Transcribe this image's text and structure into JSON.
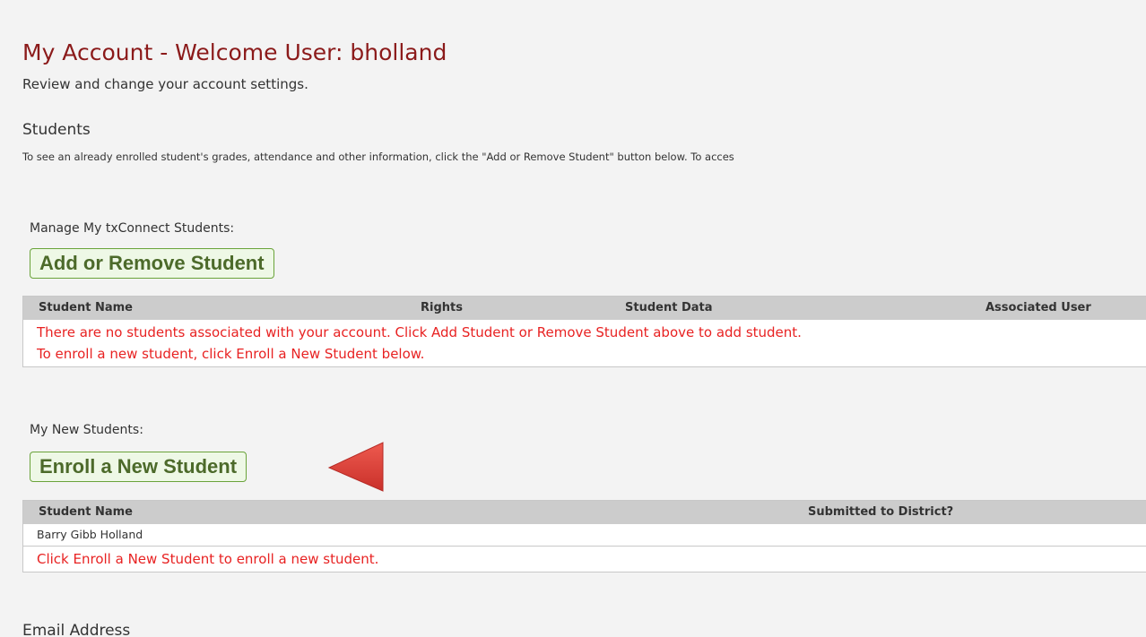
{
  "header": {
    "title": "My Account - Welcome User: bholland",
    "subtitle": "Review and change your account settings."
  },
  "students_section": {
    "heading": "Students",
    "description": "To see an already enrolled student's grades, attendance and other information, click the \"Add or Remove Student\" button below. To acces"
  },
  "manage": {
    "label": "Manage My txConnect Students:",
    "button_label": "Add or Remove Student",
    "columns": [
      "Student Name",
      "Rights",
      "Student Data",
      "Associated User"
    ],
    "empty_message_line1": "There are no students associated with your account. Click Add Student or Remove Student above to add student.",
    "empty_message_line2": "To enroll a new student, click Enroll a New Student below."
  },
  "new_students": {
    "label": "My New Students:",
    "button_label": "Enroll a New Student",
    "columns": [
      "Student Name",
      "Submitted to District?"
    ],
    "rows": [
      {
        "student_name": "Barry Gibb Holland",
        "submitted": ""
      }
    ],
    "footer_message": "Click Enroll a New Student to enroll a new student."
  },
  "email_section": {
    "heading": "Email Address"
  },
  "annotation": {
    "arrow_color": "#e0433b",
    "arrow_icon": "pointer-arrow-icon"
  },
  "colors": {
    "title": "#8b1a1a",
    "error_text": "#e82222",
    "button_bg": "#eef8e6",
    "button_border": "#6aa33a",
    "button_text": "#4c6a2a",
    "table_header_bg": "#cccccc",
    "page_bg": "#f3f3f3"
  }
}
